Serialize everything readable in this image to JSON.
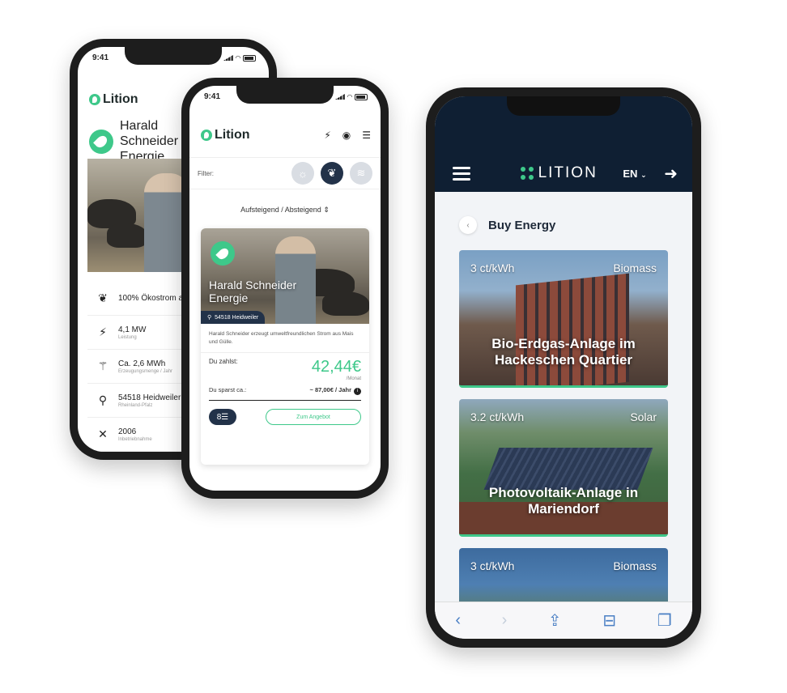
{
  "phone1": {
    "status_time": "9:41",
    "logo_text": "Lition",
    "producer_name": "Harald Schneider Energie",
    "details": [
      {
        "icon": "leaf-icon",
        "main": "100% Ökostrom aus Biogas",
        "sub": ""
      },
      {
        "icon": "bolt-icon",
        "main": "4,1 MW",
        "sub": "Leistung"
      },
      {
        "icon": "tower-icon",
        "main": "Ca. 2,6 MWh",
        "sub": "Erzeugungsmenge / Jahr"
      },
      {
        "icon": "location-icon",
        "main": "54518 Heidweiler",
        "sub": "Rheinland-Pfalz"
      },
      {
        "icon": "tools-icon",
        "main": "2006",
        "sub": "Inbetriebnahme"
      }
    ]
  },
  "phone2": {
    "status_time": "9:41",
    "logo_text": "Lition",
    "filter_label": "Filter:",
    "sort_label": "Aufsteigend / Absteigend",
    "card": {
      "title": "Harald Schneider Energie",
      "location": "54518 Heidweiler",
      "description": "Harald Schneider erzeugt umweltfreundlichen Strom aus Mais und Gülle.",
      "pay_label": "Du zahlst:",
      "price": "42,44€",
      "price_unit": "/Monat",
      "save_label": "Du sparst ca.:",
      "save_value": "~ 87,00€ / Jahr",
      "compare_label": "8☰",
      "offer_button": "Zum Angebot"
    }
  },
  "phone3": {
    "logo_text": "LITION",
    "language": "EN",
    "page_title": "Buy Energy",
    "cards": [
      {
        "price": "3 ct/kWh",
        "type": "Biomass",
        "title": "Bio-Erdgas-Anlage im Hackeschen Quartier"
      },
      {
        "price": "3.2 ct/kWh",
        "type": "Solar",
        "title": "Photovoltaik-Anlage in Mariendorf"
      },
      {
        "price": "3 ct/kWh",
        "type": "Biomass",
        "title": ""
      }
    ]
  },
  "colors": {
    "brand_green": "#3ec88a",
    "navy": "#223249",
    "dark_header": "#0f1f33"
  }
}
